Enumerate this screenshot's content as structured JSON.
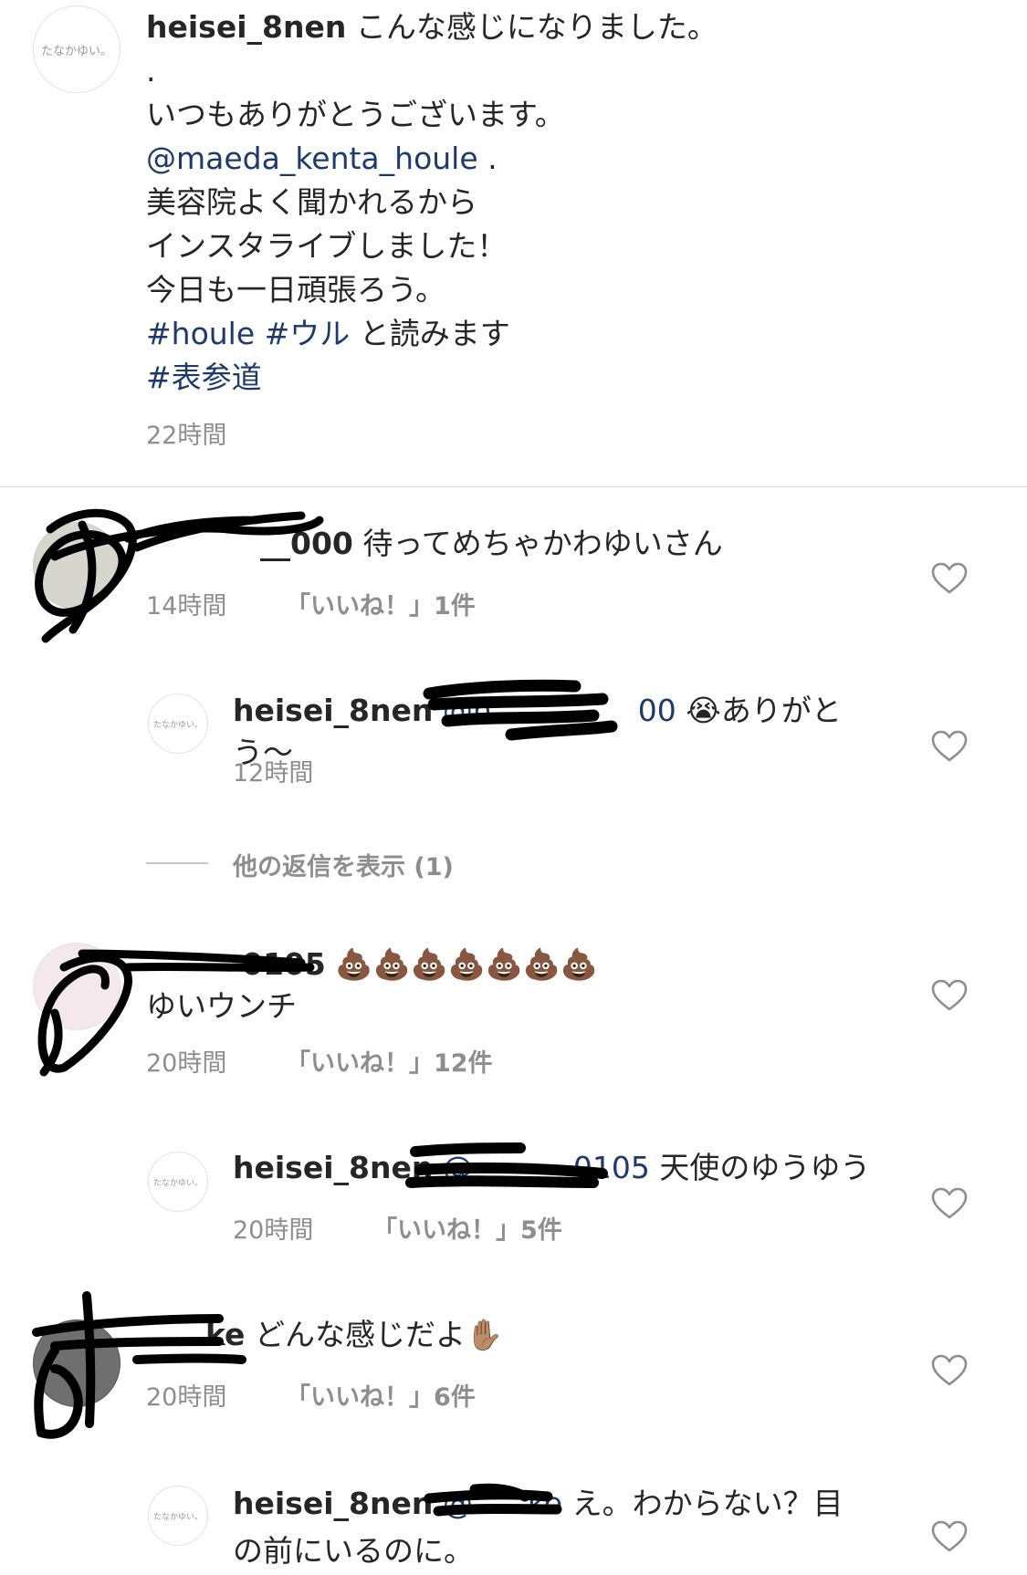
{
  "post": {
    "avatar_text": "たなかゆい。",
    "username": "heisei_8nen",
    "first_line": "こんな感じになりました。",
    "dot": ".",
    "line_thanks": "いつもありがとうございます。",
    "mention": "@maeda_kenta_houle",
    "mention_suffix": " .",
    "line_salon": "美容院よく聞かれるから",
    "line_live": "インスタライブしました！",
    "line_today": "今日も一日頑張ろう。",
    "tag_houle": "#houle",
    "tag_uru": "#ウル",
    "tag_read": " と読みます",
    "tag_omotesando": "#表参道",
    "time": "22時間"
  },
  "comments": [
    {
      "username_visible": "__000",
      "text": "待ってめちゃかわゆいさん",
      "time": "14時間",
      "likes": "「いいね！」1件"
    },
    {
      "username": "heisei_8nen",
      "mention_visible": "@n",
      "mention_tail": "00",
      "emoji": "😭",
      "text": "ありがとう〜",
      "time": "12時間",
      "avatar_text": "たなかゆい。"
    },
    {
      "username_visible": "0105",
      "emoji": "💩💩💩💩💩💩💩",
      "text": "ゆいウンチ",
      "time": "20時間",
      "likes": "「いいね！」12件"
    },
    {
      "username": "heisei_8nen",
      "mention_visible": "@",
      "mention_tail": "0105",
      "text": "天使のゆうゆう",
      "time": "20時間",
      "likes": "「いいね！」5件",
      "avatar_text": "たなかゆい。"
    },
    {
      "username_visible": "ke",
      "text": "どんな感じだよ",
      "emoji": "✋🏽",
      "time": "20時間",
      "likes": "「いいね！」6件"
    },
    {
      "username": "heisei_8nen",
      "mention_visible": "@",
      "mention_tail": "ke",
      "text": "え。わからない？目の前にいるのに。",
      "avatar_text": "たなかゆい。"
    }
  ],
  "view_more": "他の返信を表示 (1)",
  "colors": {
    "link": "#1e3a6d",
    "muted": "#8e8e8e",
    "divider": "#dbdbdb",
    "text": "#262626"
  },
  "icons": {
    "like": "heart-outline-icon"
  }
}
